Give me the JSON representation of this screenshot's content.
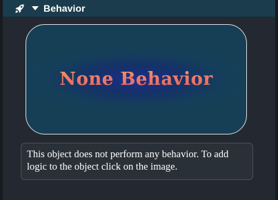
{
  "header": {
    "icon": "rocket-icon",
    "caret_icon": "caret-down-icon",
    "title": "Behavior"
  },
  "behavior_image": {
    "label": "None Behavior"
  },
  "description": {
    "text": "This object does not perform any behavior. To add logic to the object click on the image."
  },
  "colors": {
    "header_bg": "#1b3c4d",
    "panel_bg": "#232831",
    "image_bg": "#163f55",
    "image_text_gradient_top": "#f4a85c",
    "image_text_gradient_bottom": "#e0645f"
  }
}
